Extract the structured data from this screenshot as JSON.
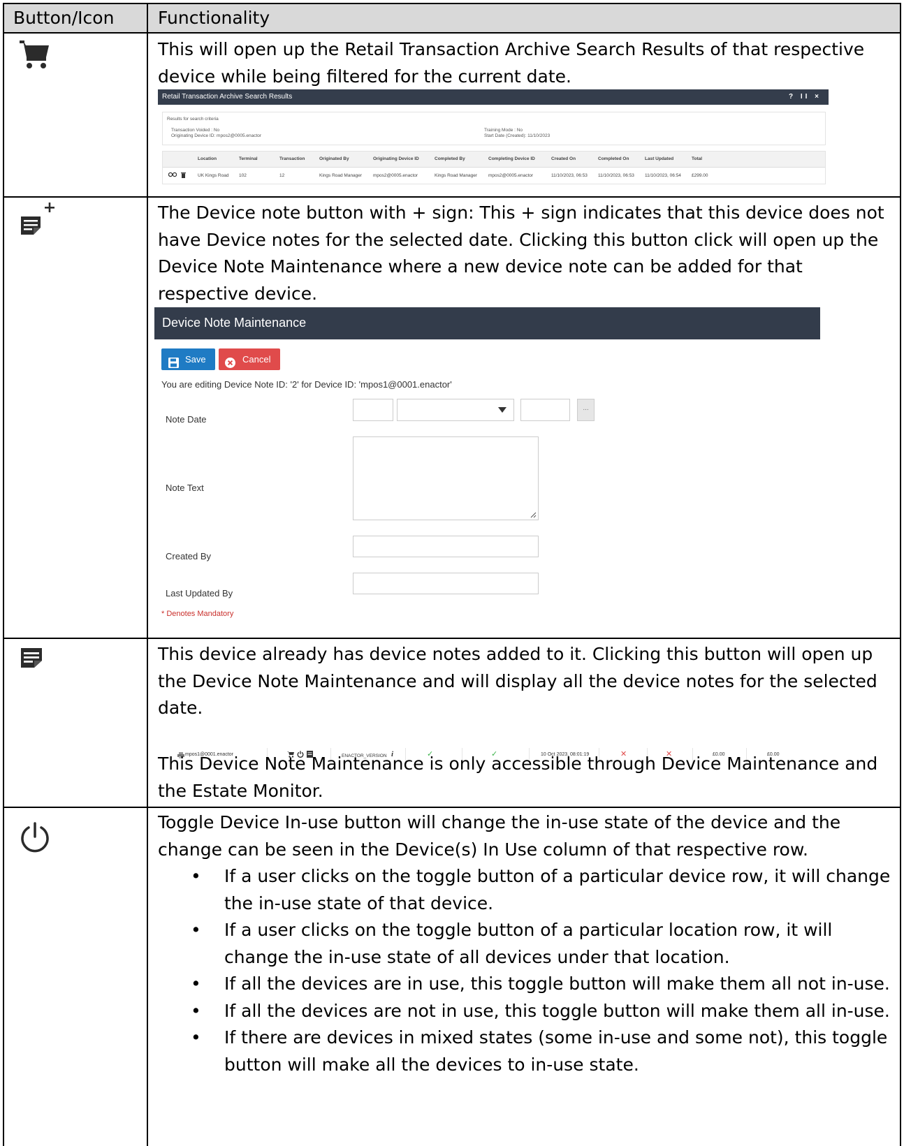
{
  "header": {
    "col1": "Button/Icon",
    "col2": "Functionality"
  },
  "row1": {
    "icon": "shopping-cart-icon",
    "text": "This will open up the Retail Transaction Archive Search Results of that respective device while being filtered for the current date.",
    "screenshot": {
      "title": "Retail Transaction Archive Search Results",
      "controls": "? II ×",
      "criteria_label": "Results for search criteria",
      "voided": "Transaction Voided : No",
      "origin_device": "Originating Device ID: mpos2@0005.enactor",
      "training": "Training Mode : No",
      "start_date": "Start Date (Created): 11/10/2023",
      "columns": [
        "Location",
        "Terminal",
        "Transaction",
        "Originated By",
        "Originating Device ID",
        "Completed By",
        "Completing Device ID",
        "Created On",
        "Completed On",
        "Last Updated",
        "Total"
      ],
      "row": [
        "UK Kings Road",
        "102",
        "12",
        "Kings Road Manager",
        "mpos2@0005.enactor",
        "Kings Road Manager",
        "mpos2@0005.enactor",
        "11/10/2023, 06:53",
        "11/10/2023, 06:53",
        "11/10/2023, 06:54",
        "£299.00"
      ]
    }
  },
  "row2": {
    "icon": "device-note-add-icon",
    "text": "The Device note button with + sign: This + sign indicates that this device does not have Device notes for the selected date. Clicking this button click will open up the Device Note Maintenance where a new device note can be added for that respective device.",
    "screenshot": {
      "title": "Device Note Maintenance",
      "save_label": "Save",
      "cancel_label": "Cancel",
      "info": "You are editing Device Note ID: '2' for Device ID: 'mpos1@0001.enactor'",
      "note_date_label": "Note Date",
      "note_text_label": "Note Text",
      "created_by_label": "Created By",
      "last_updated_by_label": "Last Updated By",
      "ellipsis": "...",
      "mandatory": "* Denotes Mandatory"
    }
  },
  "row3": {
    "icon": "device-note-icon",
    "text": "This device already has device notes added to it. Clicking this button will open up the Device Note Maintenance and will display all the device notes for the selected date.",
    "strip": {
      "device": "mpos1@0001.enactor",
      "version": "ENACTOR_VERSION",
      "date": "10 Oct 2023, 08:01:19",
      "amount1": "£0.00",
      "amount2": "£0.00"
    },
    "text2": "This Device Note Maintenance is only accessible through Device Maintenance and the Estate Monitor."
  },
  "row4": {
    "icon": "power-icon",
    "text": "Toggle Device In-use button will change the in-use state of the device and the change can be seen in the Device(s) In Use column of that respective row.",
    "bullets": [
      "If a user clicks on the toggle button of a particular device row, it will change the in-use state of that device.",
      "If a user clicks on the toggle button of a particular location row, it will change the in-use state of all devices under that location.",
      "If all the devices are in use, this toggle button will make them all not in-use.",
      "If all the devices are not in use, this toggle button will make them all in-use.",
      "If there are devices in mixed states (some in-use and some not), this toggle button will make all the devices to in-use state."
    ]
  },
  "colors": {
    "header_bg": "#d9d9d9",
    "dark_bar": "#333c4b",
    "save": "#1f7bc4",
    "cancel": "#e04b4b",
    "check": "#3cb34a",
    "cross": "#e04b4b"
  }
}
